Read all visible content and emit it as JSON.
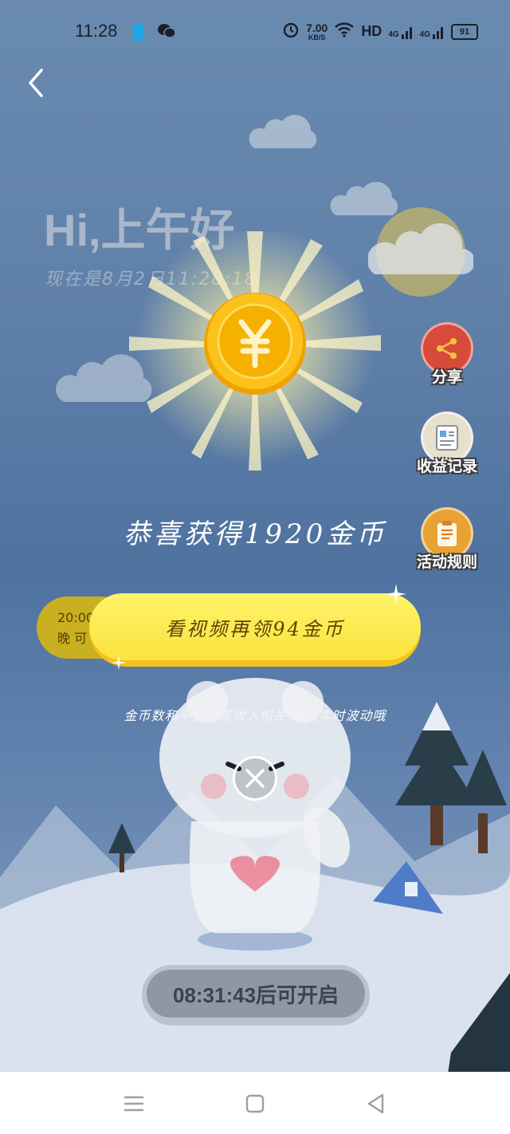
{
  "status_bar": {
    "time": "11:28",
    "speed_value": "7.00",
    "speed_unit": "KB/S",
    "network_hd": "HD",
    "signal_1": "4G",
    "signal_2": "4G",
    "battery": "91",
    "icons": [
      "qq-icon",
      "wechat-icon",
      "alarm-icon",
      "wifi-icon",
      "hd-icon",
      "signal-icon",
      "signal-icon",
      "battery-icon"
    ]
  },
  "header": {
    "back_icon": "chevron-left-icon",
    "greeting": "Hi,上午好",
    "datetime": "现在是8月2日11:28:18"
  },
  "reward": {
    "coin_icon": "yen-coin-icon",
    "congrats_text": "恭喜获得1920金币"
  },
  "side_actions": [
    {
      "label": "分享",
      "icon": "share-icon",
      "color": "#d84a3a"
    },
    {
      "label": "收益记录",
      "icon": "record-icon",
      "color": "#e6e0cf"
    },
    {
      "label": "活动规则",
      "icon": "clipboard-icon",
      "color": "#e8a234"
    }
  ],
  "tag": {
    "line1": "20:00",
    "line2": "晚 可"
  },
  "watch_button": {
    "label": "看视频再领94金币"
  },
  "note": "金币数和平台广告收入相关,会有实时波动哦",
  "timer": {
    "label": "08:31:43后可开启"
  },
  "nav": {
    "items": [
      "menu-icon",
      "home-square-icon",
      "back-triangle-icon"
    ]
  },
  "colors": {
    "button_yellow": "#fbe33e",
    "sky": "#5e7fa8",
    "coin": "#f6b500"
  }
}
